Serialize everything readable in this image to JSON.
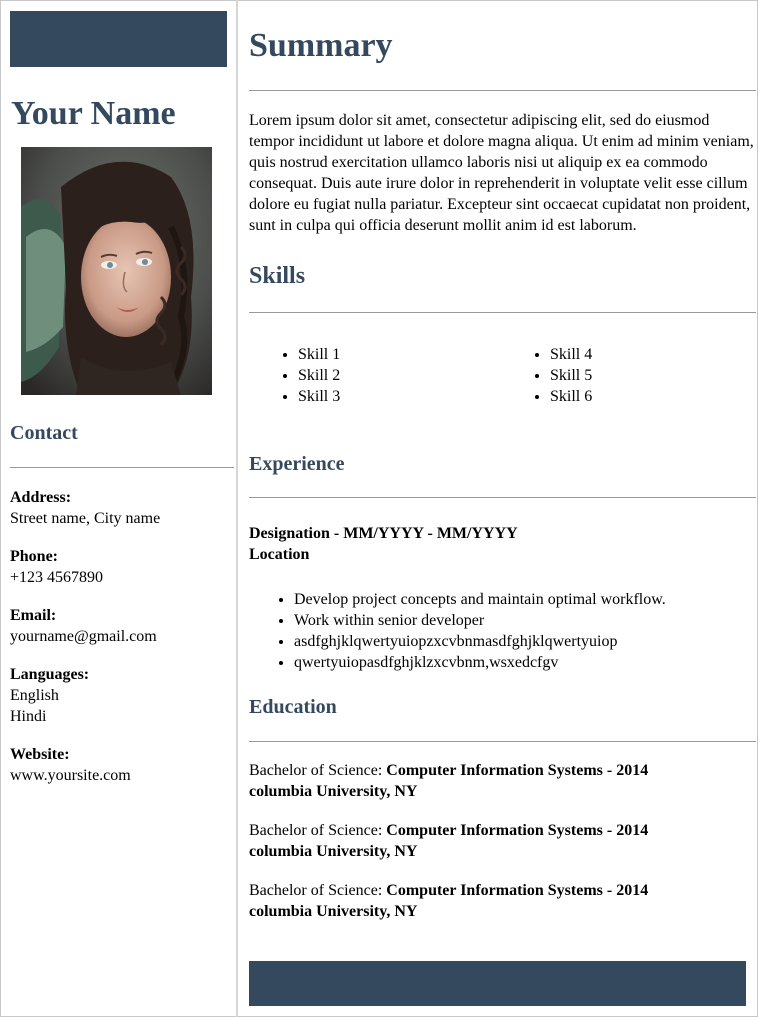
{
  "sidebar": {
    "name": "Your Name",
    "contact_heading": "Contact",
    "contacts": [
      {
        "label": "Address:",
        "lines": [
          "Street name, City name"
        ]
      },
      {
        "label": "Phone:",
        "lines": [
          "+123 4567890"
        ]
      },
      {
        "label": "Email:",
        "lines": [
          "yourname@gmail.com"
        ]
      },
      {
        "label": "Languages:",
        "lines": [
          "English",
          "Hindi"
        ]
      },
      {
        "label": "Website:",
        "lines": [
          "www.yoursite.com"
        ]
      }
    ]
  },
  "main": {
    "summary_heading": "Summary",
    "summary_text": "Lorem ipsum dolor sit amet, consectetur adipiscing elit, sed do eiusmod tempor incididunt ut labore et dolore magna aliqua. Ut enim ad minim veniam, quis nostrud exercitation ullamco laboris nisi ut aliquip ex ea commodo consequat. Duis aute irure dolor in reprehenderit in voluptate velit esse cillum dolore eu fugiat nulla pariatur. Excepteur sint occaecat cupidatat non proident, sunt in culpa qui officia deserunt mollit anim id est laborum.",
    "skills_heading": "Skills",
    "skills_left": [
      "Skill 1",
      "Skill 2",
      "Skill 3"
    ],
    "skills_right": [
      "Skill 4",
      "Skill 5",
      "Skill 6"
    ],
    "experience_heading": "Experience",
    "job_title_line": "Designation - MM/YYYY - MM/YYYY",
    "job_location": "Location",
    "tasks": [
      "Develop project concepts and maintain optimal workflow.",
      "Work within senior developer",
      "asdfghjklqwertyuiopzxcvbnmasdfghjklqwertyuiop",
      "qwertyuiopasdfghjklzxcvbnm,wsxedcfgv"
    ],
    "education_heading": "Education",
    "education": [
      {
        "degree": "Bachelor of Science: ",
        "field": "Computer Information Systems - 2014",
        "school": "columbia University, NY"
      },
      {
        "degree": "Bachelor of Science: ",
        "field": "Computer Information Systems - 2014",
        "school": "columbia University, NY"
      },
      {
        "degree": "Bachelor of Science: ",
        "field": "Computer Information Systems - 2014",
        "school": "columbia University, NY"
      }
    ]
  },
  "colors": {
    "accent": "#34495e",
    "rule": "#999999"
  }
}
